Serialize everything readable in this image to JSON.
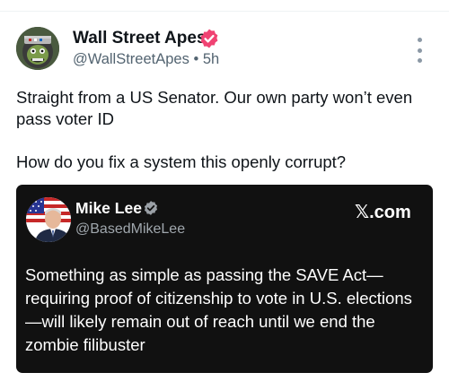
{
  "post": {
    "author_name": "Wall Street Apes",
    "author_handle": "@WallStreetApes",
    "separator": "•",
    "time": "5h",
    "text_lines": [
      "Straight from a US Senator. Our own party won’t even pass voter ID",
      "How do you fix a system this openly corrupt?"
    ],
    "icons": {
      "verified": "verified-badge-icon",
      "more": "more-options-icon"
    }
  },
  "quote": {
    "author_name": "Mike Lee",
    "author_handle": "@BasedMikeLee",
    "source": "𝕏.com",
    "text": "Something as simple as passing the SAVE Act—requiring proof of citizenship to vote in U.S. elections—will likely remain out of reach until we end the zombie filibuster"
  },
  "colors": {
    "verified_badge": "#f04373",
    "quote_background": "#111111",
    "secondary_text": "#536471"
  }
}
